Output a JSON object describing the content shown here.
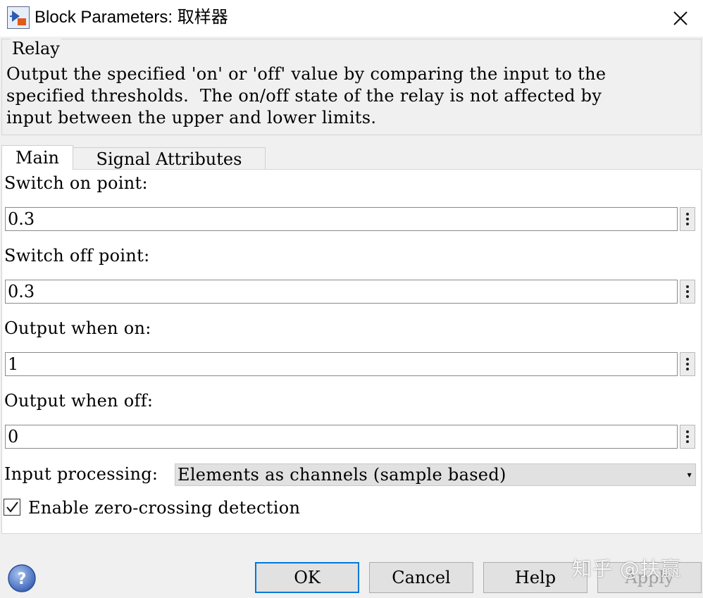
{
  "window": {
    "title": "Block Parameters: 取样器",
    "close_icon": "close-icon",
    "app_icon": "simulink-block-icon"
  },
  "description_group": {
    "legend": "Relay",
    "text": "Output the specified 'on' or 'off' value by comparing the input to the\nspecified thresholds.  The on/off state of the relay is not affected by\ninput between the upper and lower limits."
  },
  "tabs": [
    {
      "label": "Main",
      "active": true
    },
    {
      "label": "Signal Attributes",
      "active": false
    }
  ],
  "parameters": {
    "switch_on": {
      "label": "Switch on point:",
      "value": "0.3"
    },
    "switch_off": {
      "label": "Switch off point:",
      "value": "0.3"
    },
    "output_on": {
      "label": "Output when on:",
      "value": "1"
    },
    "output_off": {
      "label": "Output when off:",
      "value": "0"
    },
    "input_processing": {
      "label": "Input processing:",
      "selected": "Elements as channels (sample based)"
    },
    "zero_crossing": {
      "label": "Enable zero-crossing detection",
      "checked": true
    }
  },
  "buttons": {
    "ok": "OK",
    "cancel": "Cancel",
    "help": "Help",
    "apply": "Apply"
  },
  "watermark": "知乎 @扶赢",
  "colors": {
    "focus_border": "#0078d7",
    "panel_bg": "#ffffff",
    "dialog_bg": "#f0f0f0"
  }
}
